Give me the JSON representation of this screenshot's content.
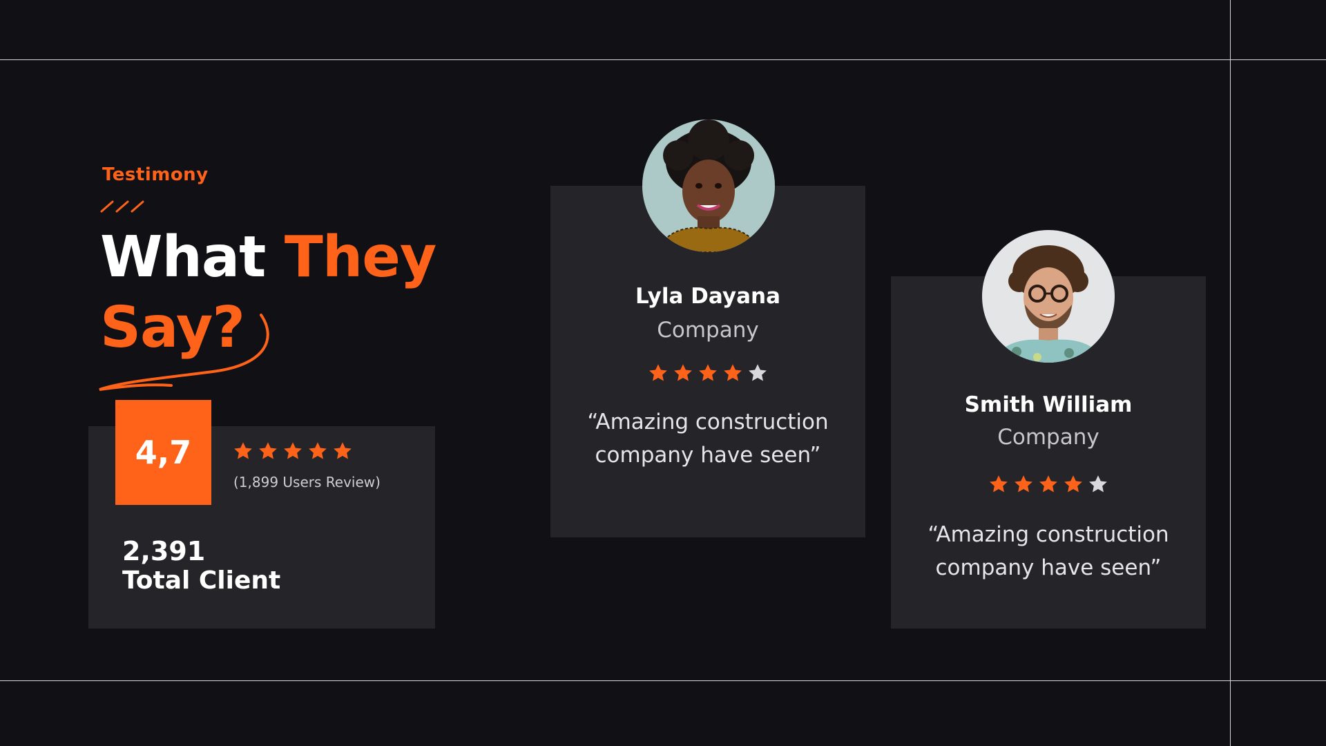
{
  "section": {
    "eyebrow": "Testimony",
    "heading_part1": "What ",
    "heading_part2": "They",
    "heading_line2": "Say?"
  },
  "stats": {
    "score": "4,7",
    "stars_filled": 5,
    "stars_total": 5,
    "reviews": "(1,899 Users Review)",
    "total_clients": "2,391",
    "total_label": "Total Client"
  },
  "testimonials": [
    {
      "name": "Lyla Dayana",
      "company": "Company",
      "rating": 4,
      "rating_max": 5,
      "quote_line1": "“Amazing construction",
      "quote_line2": "company have seen”"
    },
    {
      "name": "Smith William",
      "company": "Company",
      "rating": 4,
      "rating_max": 5,
      "quote_line1": "“Amazing construction",
      "quote_line2": "company have seen”"
    }
  ],
  "colors": {
    "accent": "#ff6319",
    "background": "#111014",
    "card": "#252429",
    "star_empty": "#d9d9dc"
  },
  "icons": {
    "star": "star-icon"
  }
}
